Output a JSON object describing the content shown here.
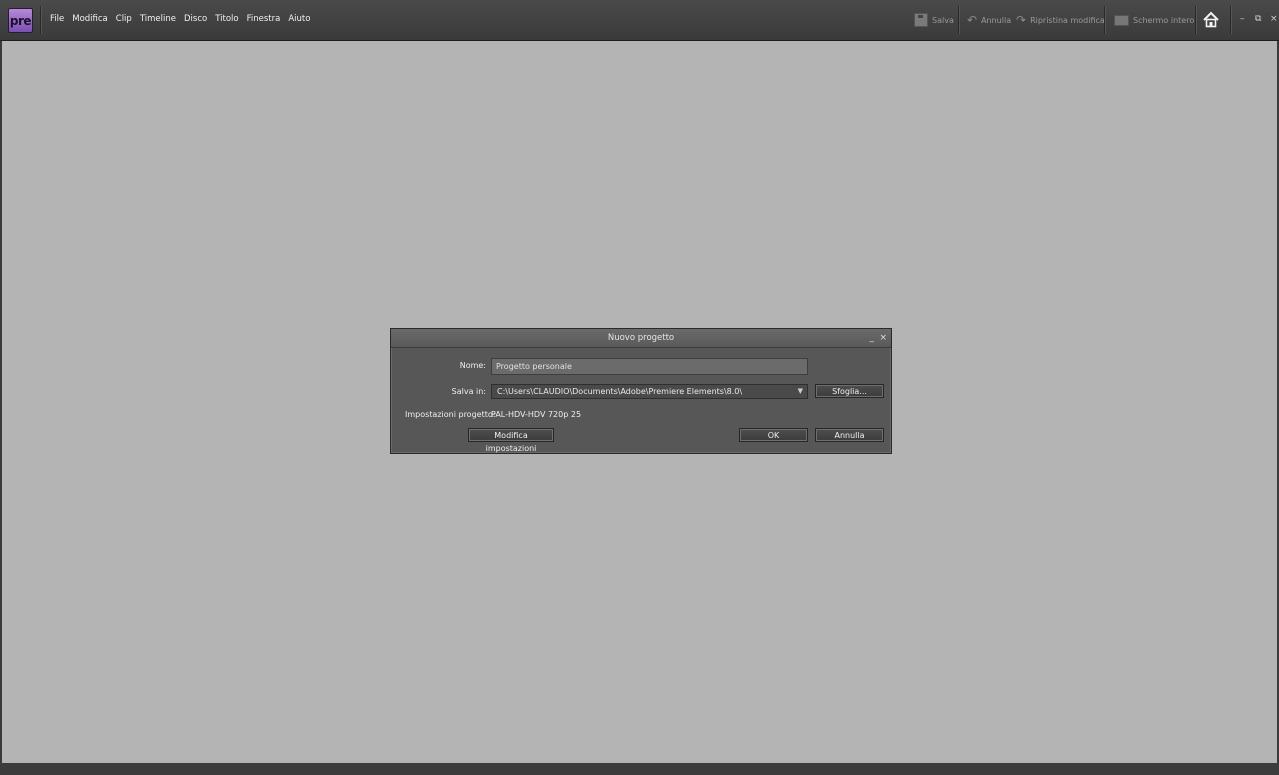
{
  "app": {
    "logo_text": "pre"
  },
  "menu": [
    "File",
    "Modifica",
    "Clip",
    "Timeline",
    "Disco",
    "Titolo",
    "Finestra",
    "Aiuto"
  ],
  "toolbar": {
    "save": "Salva",
    "undo": "Annulla",
    "redo": "Ripristina modifica",
    "fullscreen": "Schermo intero"
  },
  "window_controls": {
    "minimize": "–",
    "restore": "⧉",
    "close": "×"
  },
  "dialog": {
    "title": "Nuovo progetto",
    "minimize": "_",
    "close": "×",
    "name_label": "Nome:",
    "name_value": "Progetto personale",
    "save_in_label": "Salva in:",
    "save_in_value": "C:\\Users\\CLAUDIO\\Documents\\Adobe\\Premiere Elements\\8.0\\",
    "browse_button": "Sfoglia...",
    "settings_label": "Impostazioni progetto:",
    "settings_value": "PAL-HDV-HDV 720p 25",
    "change_settings_button": "Modifica impostazioni",
    "ok_button": "OK",
    "cancel_button": "Annulla"
  },
  "colors": {
    "workspace": "#b4b4b4",
    "chrome": "#3a3a3a",
    "dialog": "#575757",
    "logo": "#9b6cc8"
  }
}
